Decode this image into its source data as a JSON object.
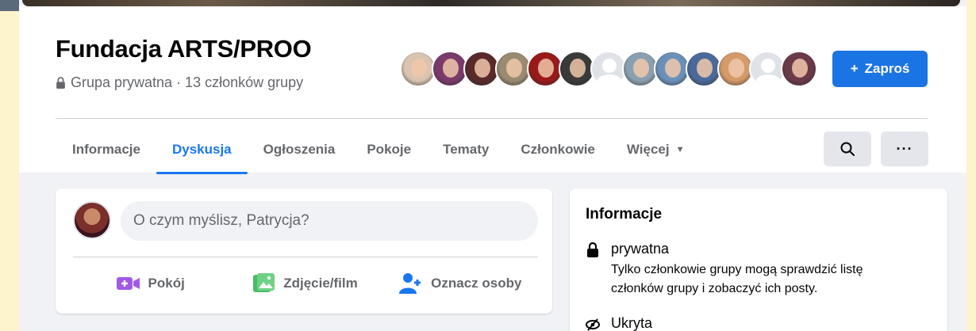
{
  "group": {
    "name": "Fundacja ARTS/PROO",
    "privacy_meta": "Grupa prywatna · 13 członków grupy",
    "invite_label": "Zaproś",
    "invite_plus": "+"
  },
  "colors": {
    "accent": "#1877f2",
    "button_blue": "#1b74e4",
    "muted_text": "#65676b",
    "background": "#f0f2f5"
  },
  "members": {
    "avatars": [
      {
        "kind": "photo",
        "color": "#d8c4b0"
      },
      {
        "kind": "photo",
        "color": "#7a3a6a"
      },
      {
        "kind": "photo",
        "color": "#5a2a2a"
      },
      {
        "kind": "photo",
        "color": "#9a8a70"
      },
      {
        "kind": "photo",
        "color": "#9a1a1a"
      },
      {
        "kind": "photo",
        "color": "#3a3a3a"
      },
      {
        "kind": "blank",
        "color": "#dfe3e8"
      },
      {
        "kind": "photo",
        "color": "#8aa0b0"
      },
      {
        "kind": "photo",
        "color": "#6a90b8"
      },
      {
        "kind": "photo",
        "color": "#4a6a9a"
      },
      {
        "kind": "photo",
        "color": "#d49a6a"
      },
      {
        "kind": "blank",
        "color": "#dfe3e8"
      },
      {
        "kind": "photo",
        "color": "#6a3a4a"
      }
    ]
  },
  "tabs": [
    {
      "label": "Informacje",
      "active": false
    },
    {
      "label": "Dyskusja",
      "active": true
    },
    {
      "label": "Ogłoszenia",
      "active": false
    },
    {
      "label": "Pokoje",
      "active": false
    },
    {
      "label": "Tematy",
      "active": false
    },
    {
      "label": "Członkowie",
      "active": false
    },
    {
      "label": "Więcej",
      "active": false,
      "has_caret": true
    }
  ],
  "tab_icons": [
    "search-icon",
    "more-icon"
  ],
  "more_icon_text": "···",
  "composer": {
    "placeholder": "O czym myślisz, Patrycja?",
    "actions": [
      {
        "label": "Pokój",
        "icon": "video-room-icon",
        "color": "#a259e6"
      },
      {
        "label": "Zdjęcie/film",
        "icon": "photo-icon",
        "color": "#45bd62"
      },
      {
        "label": "Oznacz osoby",
        "icon": "tag-people-icon",
        "color": "#1877f2"
      }
    ]
  },
  "info": {
    "title": "Informacje",
    "private_heading": "prywatna",
    "private_desc": "Tylko członkowie grupy mogą sprawdzić listę członków grupy i zobaczyć ich posty.",
    "hidden_heading": "Ukryta"
  }
}
